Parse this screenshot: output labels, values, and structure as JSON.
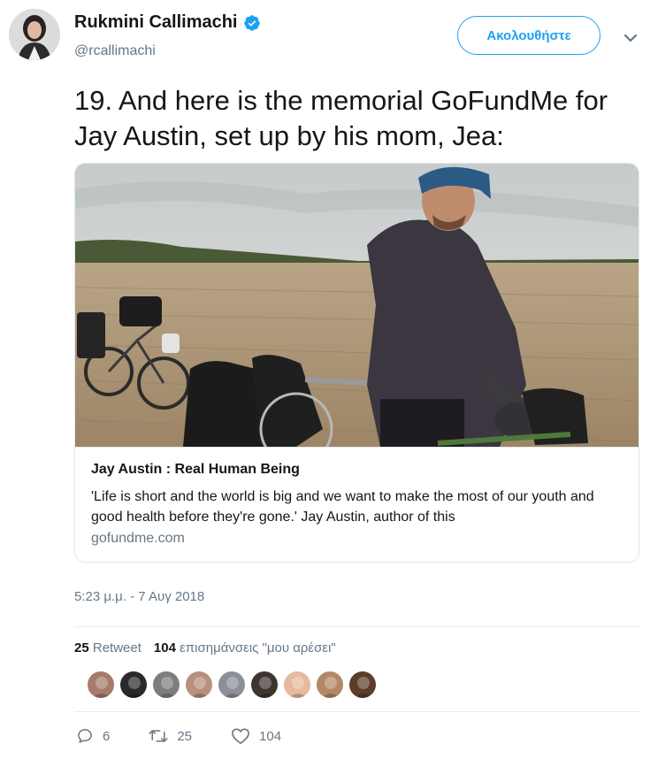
{
  "author": {
    "display_name": "Rukmini Callimachi",
    "handle": "@rcallimachi",
    "verified_icon": "verified-badge-icon"
  },
  "follow_label": "Ακολουθήστε",
  "tweet_text": "19. And here is the memorial GoFundMe for Jay Austin, set up by his mom, Jea:",
  "card": {
    "title": "Jay Austin : Real Human Being",
    "description": "'Life is short and the world is big and we want to make the most of our youth and good health before they're gone.' Jay Austin, author of this",
    "domain": "gofundme.com"
  },
  "timestamp": "5:23 μ.μ. - 7 Αυγ 2018",
  "stats": {
    "retweets_count": "25",
    "retweets_label": "Retweet",
    "likes_count": "104",
    "likes_label": "επισημάνσεις \"μου αρέσει\""
  },
  "liker_colors": [
    "#a67b6b",
    "#2b2a2a",
    "#7d7d7d",
    "#b98f7d",
    "#8c8f96",
    "#3e3430",
    "#e6b9a0",
    "#b48867",
    "#5b3d2a"
  ],
  "actions": {
    "reply_count": "6",
    "retweet_count": "25",
    "like_count": "104"
  },
  "colors": {
    "accent": "#1da1f2",
    "muted": "#657786",
    "text": "#14171a"
  }
}
